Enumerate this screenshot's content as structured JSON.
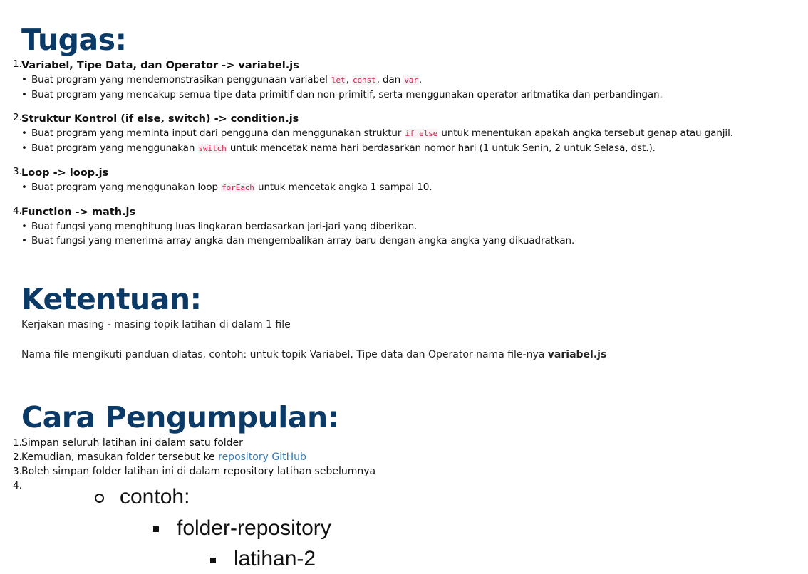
{
  "tugas": {
    "heading": "Tugas:",
    "tasks": [
      {
        "title": "Variabel, Tipe Data, dan Operator -> variabel.js",
        "bullets": [
          {
            "pre": "Buat program yang mendemonstrasikan penggunaan variabel ",
            "code1": "let",
            "mid1": ", ",
            "code2": "const",
            "mid2": ", dan ",
            "code3": "var",
            "post": "."
          },
          {
            "text": "Buat program yang mencakup semua tipe data primitif dan non-primitif, serta menggunakan operator aritmatika dan perbandingan."
          }
        ]
      },
      {
        "title": "Struktur Kontrol (if else, switch) -> condition.js",
        "bullets": [
          {
            "pre": "Buat program yang meminta input dari pengguna dan menggunakan struktur ",
            "code": "if else",
            "post": " untuk menentukan apakah angka tersebut genap atau ganjil."
          },
          {
            "pre": "Buat program yang menggunakan ",
            "code": "switch",
            "post": " untuk mencetak nama hari berdasarkan nomor hari (1 untuk Senin, 2 untuk Selasa, dst.)."
          }
        ]
      },
      {
        "title": "Loop -> loop.js",
        "bullets": [
          {
            "pre": "Buat program yang menggunakan loop ",
            "code": "forEach",
            "post": " untuk mencetak angka 1 sampai 10."
          }
        ]
      },
      {
        "title": "Function -> math.js",
        "bullets": [
          {
            "text": "Buat fungsi yang menghitung luas lingkaran berdasarkan jari-jari yang diberikan."
          },
          {
            "text": "Buat fungsi yang menerima array angka dan mengembalikan array baru dengan angka-angka yang dikuadratkan."
          }
        ]
      }
    ]
  },
  "ketentuan": {
    "heading": "Ketentuan:",
    "line1": "Kerjakan masing - masing topik latihan di dalam 1 file",
    "line2_pre": "Nama file mengikuti panduan diatas, contoh: untuk topik Variabel, Tipe data dan Operator nama file-nya ",
    "line2_bold": "variabel.js"
  },
  "cara": {
    "heading": "Cara Pengumpulan:",
    "steps": [
      {
        "text": "Simpan seluruh latihan ini dalam satu folder"
      },
      {
        "pre": "Kemudian, masukan folder tersebut ke ",
        "link": "repository GitHub"
      },
      {
        "text": "Boleh simpan folder latihan ini di dalam repository latihan sebelumnya"
      },
      {
        "text": ""
      }
    ],
    "tree": {
      "l1": "contoh:",
      "l2": "folder-repository",
      "l3": "latihan-2"
    }
  },
  "colors": {
    "heading": "#0b3a66",
    "link": "#337ab7",
    "code": "#c7254e"
  }
}
